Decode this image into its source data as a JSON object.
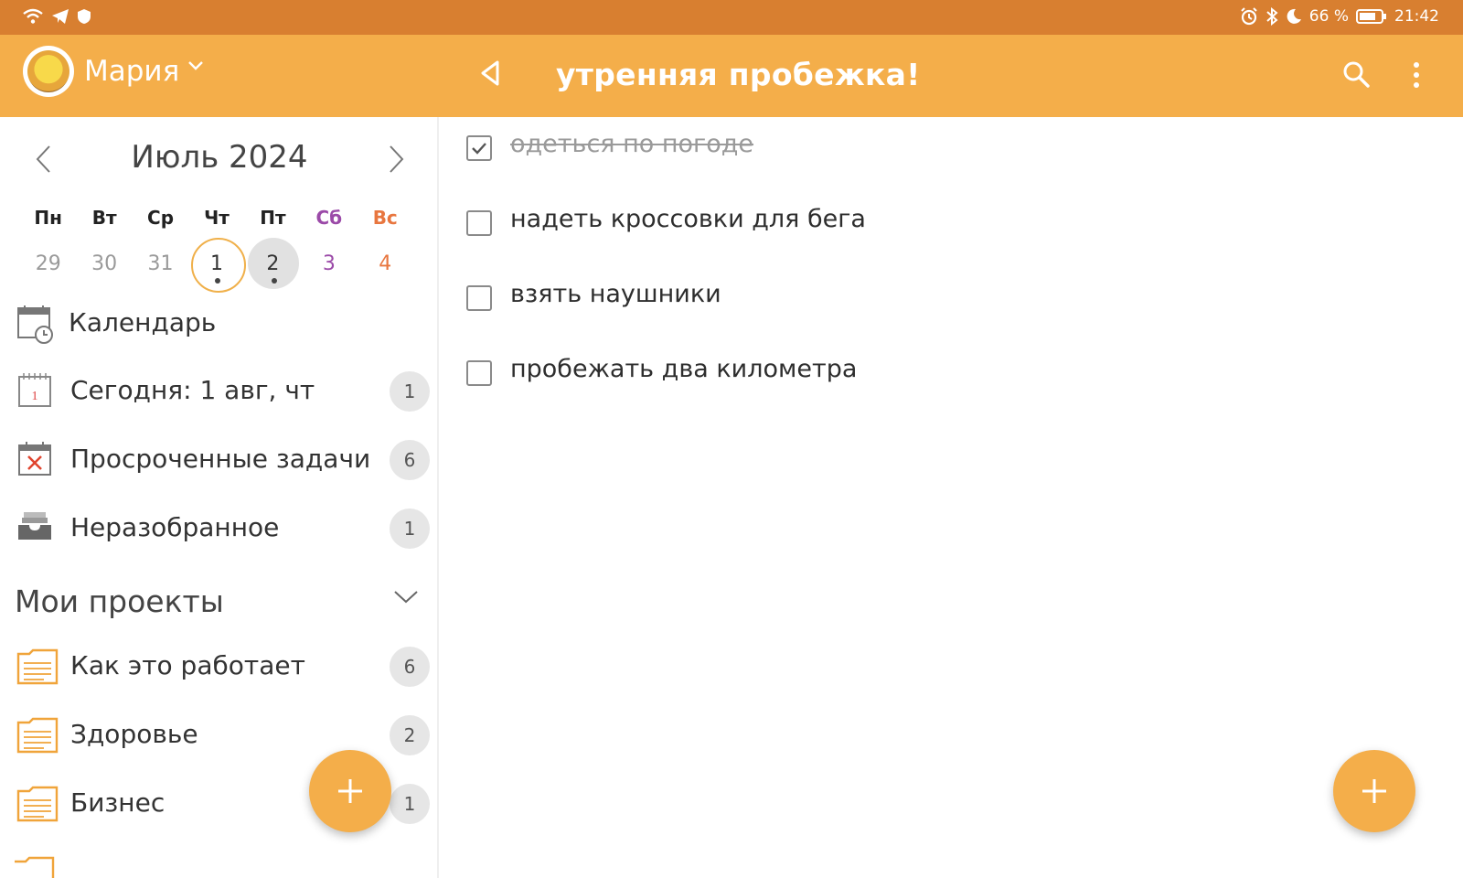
{
  "status_bar": {
    "battery": "66 %",
    "time": "21:42"
  },
  "header": {
    "user_name": "Мария",
    "title": "утренняя пробежка!"
  },
  "calendar": {
    "month_label": "Июль 2024",
    "weekdays": [
      "Пн",
      "Вт",
      "Ср",
      "Чт",
      "Пт",
      "Сб",
      "Вс"
    ],
    "days": [
      "29",
      "30",
      "31",
      "1",
      "2",
      "3",
      "4"
    ]
  },
  "nav": {
    "calendar": "Календарь",
    "today": "Сегодня: 1 авг, чт",
    "today_count": "1",
    "overdue": "Просроченные задачи",
    "overdue_count": "6",
    "inbox": "Неразобранное",
    "inbox_count": "1"
  },
  "projects": {
    "header": "Мои проекты",
    "items": [
      {
        "label": "Как это работает",
        "count": "6"
      },
      {
        "label": "Здоровье",
        "count": "2"
      },
      {
        "label": "Бизнес",
        "count": "1"
      }
    ]
  },
  "tasks": [
    {
      "text": "одеться по погоде",
      "done": true
    },
    {
      "text": "надеть кроссовки для бега",
      "done": false
    },
    {
      "text": "взять наушники",
      "done": false
    },
    {
      "text": "пробежать два километра",
      "done": false
    }
  ],
  "colors": {
    "status_bar": "#d87f30",
    "app_bar": "#f4ae4a",
    "accent": "#f4ae4a",
    "saturday": "#9b4aa8",
    "sunday": "#e8763f"
  }
}
